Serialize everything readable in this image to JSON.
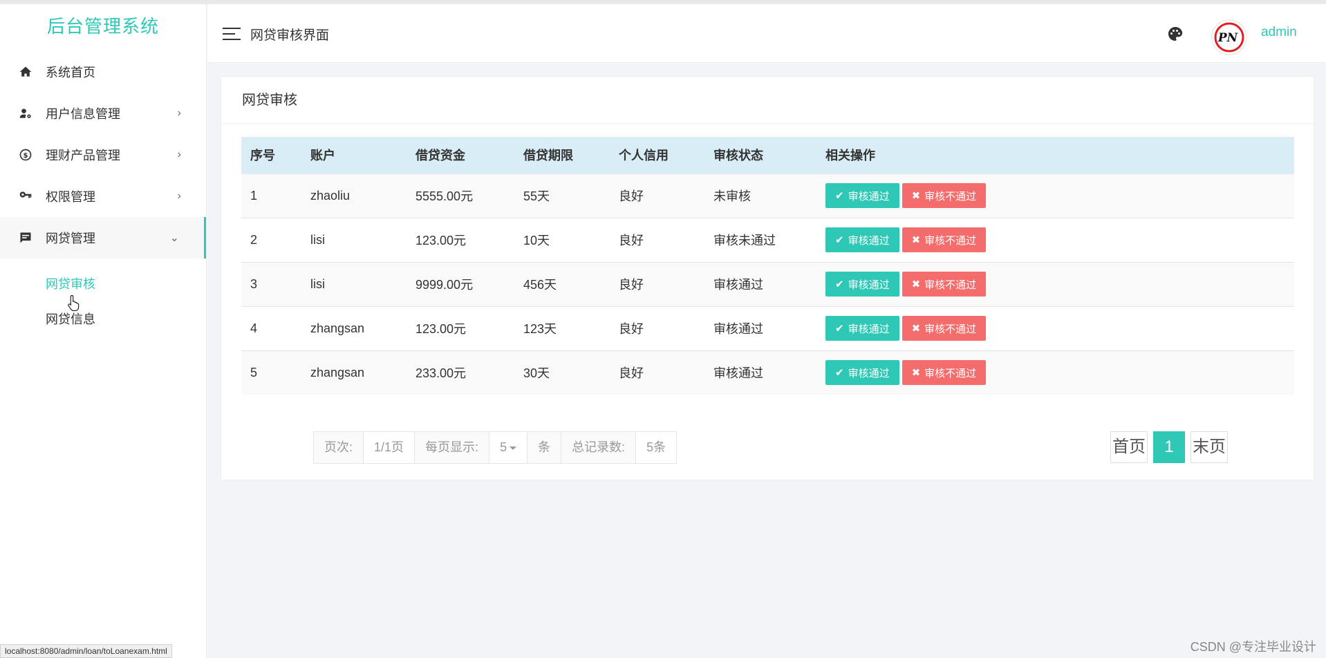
{
  "app": {
    "brand": "后台管理系统"
  },
  "sidebar": {
    "items": [
      {
        "label": "系统首页",
        "icon": "home-icon",
        "arrow": ""
      },
      {
        "label": "用户信息管理",
        "icon": "user-settings-icon",
        "arrow": "›"
      },
      {
        "label": "理财产品管理",
        "icon": "dollar-circle-icon",
        "arrow": "›"
      },
      {
        "label": "权限管理",
        "icon": "key-icon",
        "arrow": "›"
      },
      {
        "label": "网贷管理",
        "icon": "message-icon",
        "arrow": "⌄"
      }
    ],
    "subitems": [
      {
        "label": "网贷审核"
      },
      {
        "label": "网贷信息"
      }
    ]
  },
  "header": {
    "title": "网贷审核界面",
    "username": "admin",
    "avatar_text": "PN"
  },
  "card": {
    "title": "网贷审核"
  },
  "table": {
    "columns": [
      "序号",
      "账户",
      "借贷资金",
      "借贷期限",
      "个人信用",
      "审核状态",
      "相关操作"
    ],
    "rows": [
      {
        "id": "1",
        "account": "zhaoliu",
        "amount": "5555.00元",
        "term": "55天",
        "credit": "良好",
        "status": "未审核"
      },
      {
        "id": "2",
        "account": "lisi",
        "amount": "123.00元",
        "term": "10天",
        "credit": "良好",
        "status": "审核未通过"
      },
      {
        "id": "3",
        "account": "lisi",
        "amount": "9999.00元",
        "term": "456天",
        "credit": "良好",
        "status": "审核通过"
      },
      {
        "id": "4",
        "account": "zhangsan",
        "amount": "123.00元",
        "term": "123天",
        "credit": "良好",
        "status": "审核通过"
      },
      {
        "id": "5",
        "account": "zhangsan",
        "amount": "233.00元",
        "term": "30天",
        "credit": "良好",
        "status": "审核通过"
      }
    ],
    "actions": {
      "pass": "审核通过",
      "reject": "审核不通过"
    }
  },
  "pagination": {
    "page_label": "页次:",
    "page_value": "1/1页",
    "per_page_label": "每页显示:",
    "per_page_value": "5",
    "per_page_unit": "条",
    "total_label": "总记录数:",
    "total_value": "5条",
    "first": "首页",
    "current": "1",
    "last": "末页"
  },
  "statusbar": {
    "url": "localhost:8080/admin/loan/toLoanexam.html"
  },
  "watermark": "CSDN @专注毕业设计",
  "colors": {
    "accent": "#2fc8b7",
    "danger": "#f56c6c",
    "table_header": "#d9edf6"
  }
}
